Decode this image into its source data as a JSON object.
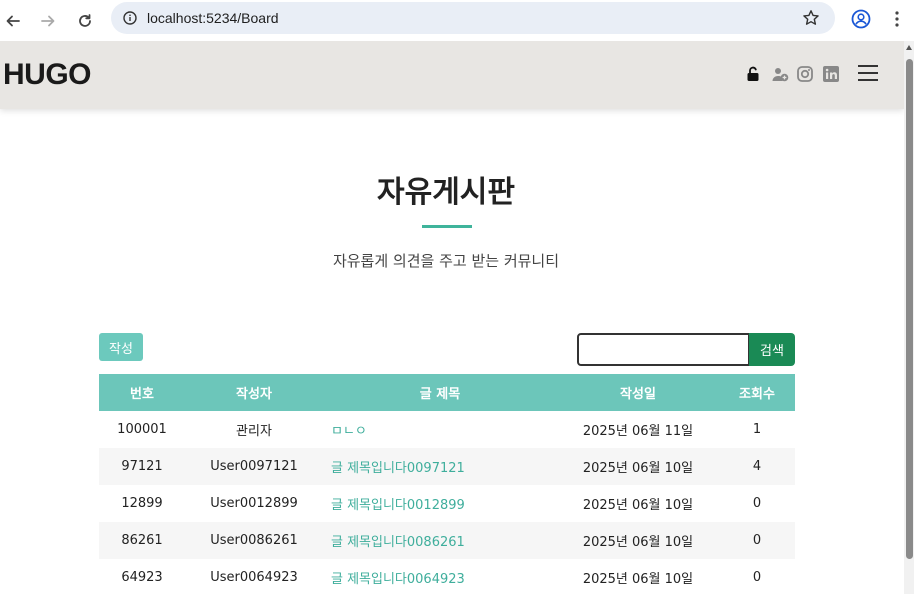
{
  "browser": {
    "url": "localhost:5234/Board",
    "icons": [
      "back-icon",
      "forward-icon",
      "reload-icon",
      "info-icon",
      "star-icon",
      "profile-icon",
      "kebab-menu-icon"
    ]
  },
  "header": {
    "logo": "HUGO",
    "icons": [
      "unlock-icon",
      "user-plus-icon",
      "instagram-icon",
      "linkedin-icon",
      "hamburger-icon"
    ]
  },
  "board": {
    "title": "자유게시판",
    "subtitle": "자유롭게 의견을 주고 받는 커뮤니티",
    "write_label": "작성",
    "search_value": "",
    "search_label": "검색",
    "columns": [
      "번호",
      "작성자",
      "글 제목",
      "작성일",
      "조회수"
    ],
    "rows": [
      {
        "no": "100001",
        "author": "관리자",
        "title": "ㅁㄴㅇ",
        "date": "2025년 06월 11일",
        "views": "1"
      },
      {
        "no": "97121",
        "author": "User0097121",
        "title": "글 제목입니다0097121",
        "date": "2025년 06월 10일",
        "views": "4"
      },
      {
        "no": "12899",
        "author": "User0012899",
        "title": "글 제목입니다0012899",
        "date": "2025년 06월 10일",
        "views": "0"
      },
      {
        "no": "86261",
        "author": "User0086261",
        "title": "글 제목입니다0086261",
        "date": "2025년 06월 10일",
        "views": "0"
      },
      {
        "no": "64923",
        "author": "User0064923",
        "title": "글 제목입니다0064923",
        "date": "2025년 06월 10일",
        "views": "0"
      }
    ]
  },
  "colors": {
    "accent": "#3fb49b",
    "table_header": "#6cc6ba",
    "search_button": "#1a8a55",
    "header_bg": "#e8e6e3"
  }
}
